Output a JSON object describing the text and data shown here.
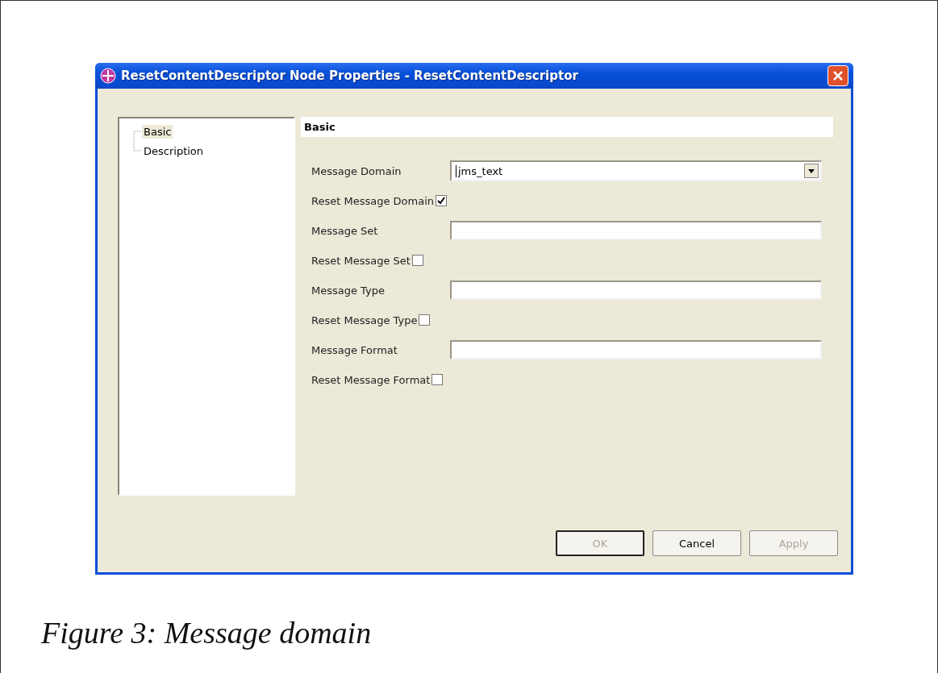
{
  "window": {
    "title": "ResetContentDescriptor Node Properties - ResetContentDescriptor"
  },
  "tree": {
    "items": [
      {
        "label": "Basic",
        "selected": true
      },
      {
        "label": "Description",
        "selected": false
      }
    ]
  },
  "panel": {
    "title": "Basic",
    "fields": [
      {
        "kind": "combo",
        "label": "Message Domain",
        "value": "jms_text"
      },
      {
        "kind": "checkbox",
        "label": "Reset Message Domain",
        "checked": true
      },
      {
        "kind": "text",
        "label": "Message Set"
      },
      {
        "kind": "checkbox",
        "label": "Reset Message Set",
        "checked": false
      },
      {
        "kind": "text",
        "label": "Message Type"
      },
      {
        "kind": "checkbox",
        "label": "Reset Message Type",
        "checked": false
      },
      {
        "kind": "text",
        "label": "Message Format"
      },
      {
        "kind": "checkbox",
        "label": "Reset Message Format",
        "checked": false
      }
    ]
  },
  "buttons": [
    {
      "label": "OK",
      "disabled": true
    },
    {
      "label": "Cancel",
      "disabled": false
    },
    {
      "label": "Apply",
      "disabled": true
    }
  ],
  "caption": "Figure 3: Message domain"
}
